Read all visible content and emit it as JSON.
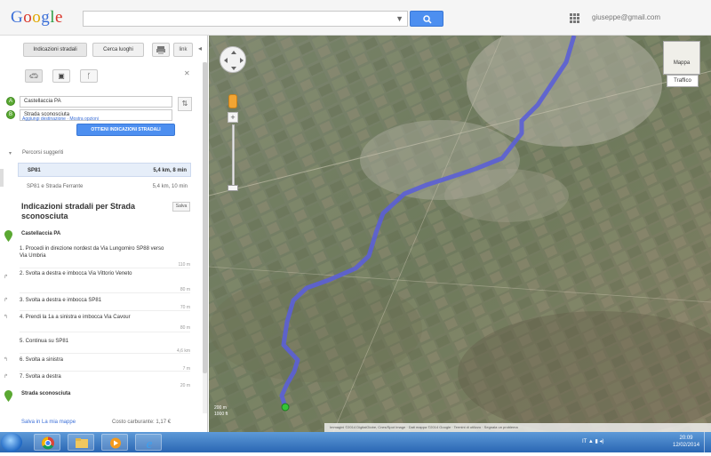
{
  "topbar": {
    "logo": "Google",
    "search_value": "",
    "account": "giuseppe@gmail.com"
  },
  "panel": {
    "tab_directions": "Indicazioni stradali",
    "tab_local": "Cerca luoghi",
    "link_label": "link",
    "origin": "Castellaccia PA",
    "destination": "Strada sconosciuta",
    "add_destination": "Aggiungi destinazione · Mostra opzioni",
    "show_button": "OTTIENI INDICAZIONI STRADALI",
    "routes_header": "Percorsi suggeriti",
    "routes": [
      {
        "name": "SP81",
        "detail": "5,4 km, 8 min"
      },
      {
        "name": "SP81 e Strada Ferrante",
        "detail": "5,4 km, 10 min"
      }
    ],
    "directions_title": "Indicazioni stradali per Strada sconosciuta",
    "directions_btn": "Salva",
    "origin_label": "Castellaccia PA",
    "steps": [
      {
        "text": "1. Procedi in direzione nordest da Via Lungomiro SP88 verso Via Umbria",
        "dist": "110 m",
        "icon": ""
      },
      {
        "text": "2. Svolta a destra e imbocca Via Vittorio Veneto",
        "dist": "80 m",
        "icon": "↱"
      },
      {
        "text": "3. Svolta a destra e imbocca SP81",
        "dist": "70 m",
        "icon": "↱"
      },
      {
        "text": "4. Prendi la 1a a sinistra e imbocca Via Cavour",
        "dist": "80 m",
        "icon": "↰"
      },
      {
        "text": "5. Continua su SP81",
        "dist": "4,6 km",
        "icon": ""
      },
      {
        "text": "6. Svolta a sinistra",
        "dist": "7 m",
        "icon": "↰"
      },
      {
        "text": "7. Svolta a destra",
        "dist": "20 m",
        "icon": "↱"
      }
    ],
    "destination_label": "Strada sconosciuta",
    "save_link": "Salva in La mia mappe",
    "fuel_cost": "Costo carburante: 1,17 €"
  },
  "map": {
    "layer_label": "Mappa",
    "traffic_label": "Traffico",
    "scale_top": "200 m",
    "scale_bottom": "1000 ft",
    "attribution": "Immagini ©2014 DigitalGlobe, Cnes/Spot Image · Dati mappa ©2014 Google · Termini di utilizzo · Segnala un problema",
    "route_color": "#5b5fd6"
  },
  "taskbar": {
    "time": "20:09",
    "date": "12/02/2014",
    "tray": "IT ▲ ▮ ◂)"
  }
}
